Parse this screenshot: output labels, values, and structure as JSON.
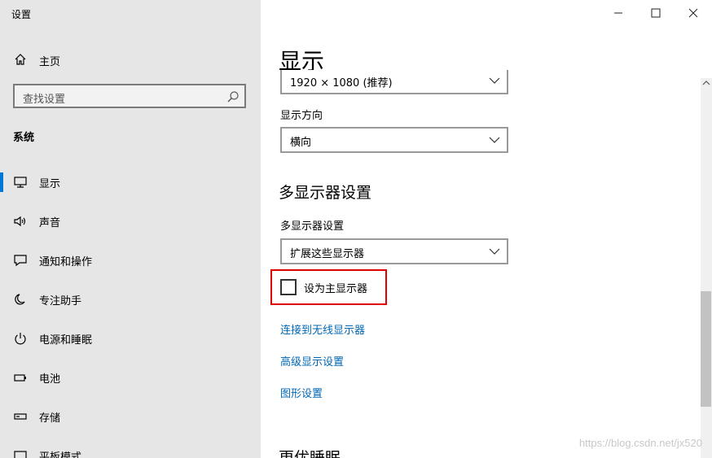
{
  "window": {
    "title": "设置"
  },
  "sidebar": {
    "home_label": "主页",
    "search_placeholder": "查找设置",
    "section_label": "系统",
    "items": [
      {
        "label": "显示",
        "icon": "monitor-icon",
        "active": true
      },
      {
        "label": "声音",
        "icon": "speaker-icon"
      },
      {
        "label": "通知和操作",
        "icon": "message-icon"
      },
      {
        "label": "专注助手",
        "icon": "moon-icon"
      },
      {
        "label": "电源和睡眠",
        "icon": "power-icon"
      },
      {
        "label": "电池",
        "icon": "battery-icon"
      },
      {
        "label": "存储",
        "icon": "storage-icon"
      },
      {
        "label": "平板模式",
        "icon": "tablet-icon"
      }
    ]
  },
  "main": {
    "page_title": "显示",
    "resolution_value": "1920 × 1080 (推荐)",
    "orientation_label": "显示方向",
    "orientation_value": "横向",
    "multi_display_heading": "多显示器设置",
    "multi_display_label": "多显示器设置",
    "multi_display_value": "扩展这些显示器",
    "primary_checkbox_label": "设为主显示器",
    "primary_checkbox_checked": false,
    "links": [
      "连接到无线显示器",
      "高级显示设置",
      "图形设置"
    ],
    "next_section_heading": "更优睡眠"
  },
  "watermark": "https://blog.csdn.net/jx520",
  "colors": {
    "accent": "#0078d7",
    "link": "#0066b4",
    "highlight_border": "#e00000",
    "sidebar_bg": "#e6e6e6"
  }
}
